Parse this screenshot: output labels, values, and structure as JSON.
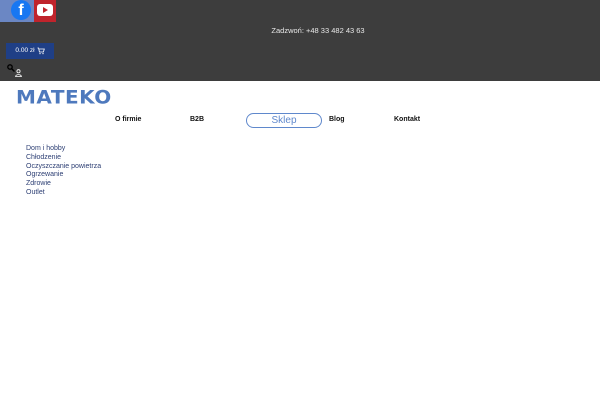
{
  "header": {
    "phone_text": "Zadzwoń: +48 33 482 43 63",
    "cart_label": "0.00 zł",
    "icons": [
      "facebook-icon",
      "youtube-icon",
      "cart-icon",
      "search-icon",
      "user-icon"
    ]
  },
  "logo": {
    "text": "MATEKO"
  },
  "nav": {
    "items": [
      {
        "label": "O firmie"
      },
      {
        "label": "B2B"
      },
      {
        "label": "Sklep"
      },
      {
        "label": "Blog"
      },
      {
        "label": "Kontakt"
      }
    ],
    "active_index": 2
  },
  "categories": [
    "Dom i hobby",
    "Chłodzenie",
    "Oczyszczanie powietrza",
    "Ogrzewanie",
    "Zdrowie",
    "Outlet"
  ],
  "colors": {
    "topbar": "#3d3d3d",
    "cart_button": "#1f3f86",
    "brand": "#4e79bd",
    "active_nav": "#5f88cc",
    "link": "#2c3e73"
  }
}
